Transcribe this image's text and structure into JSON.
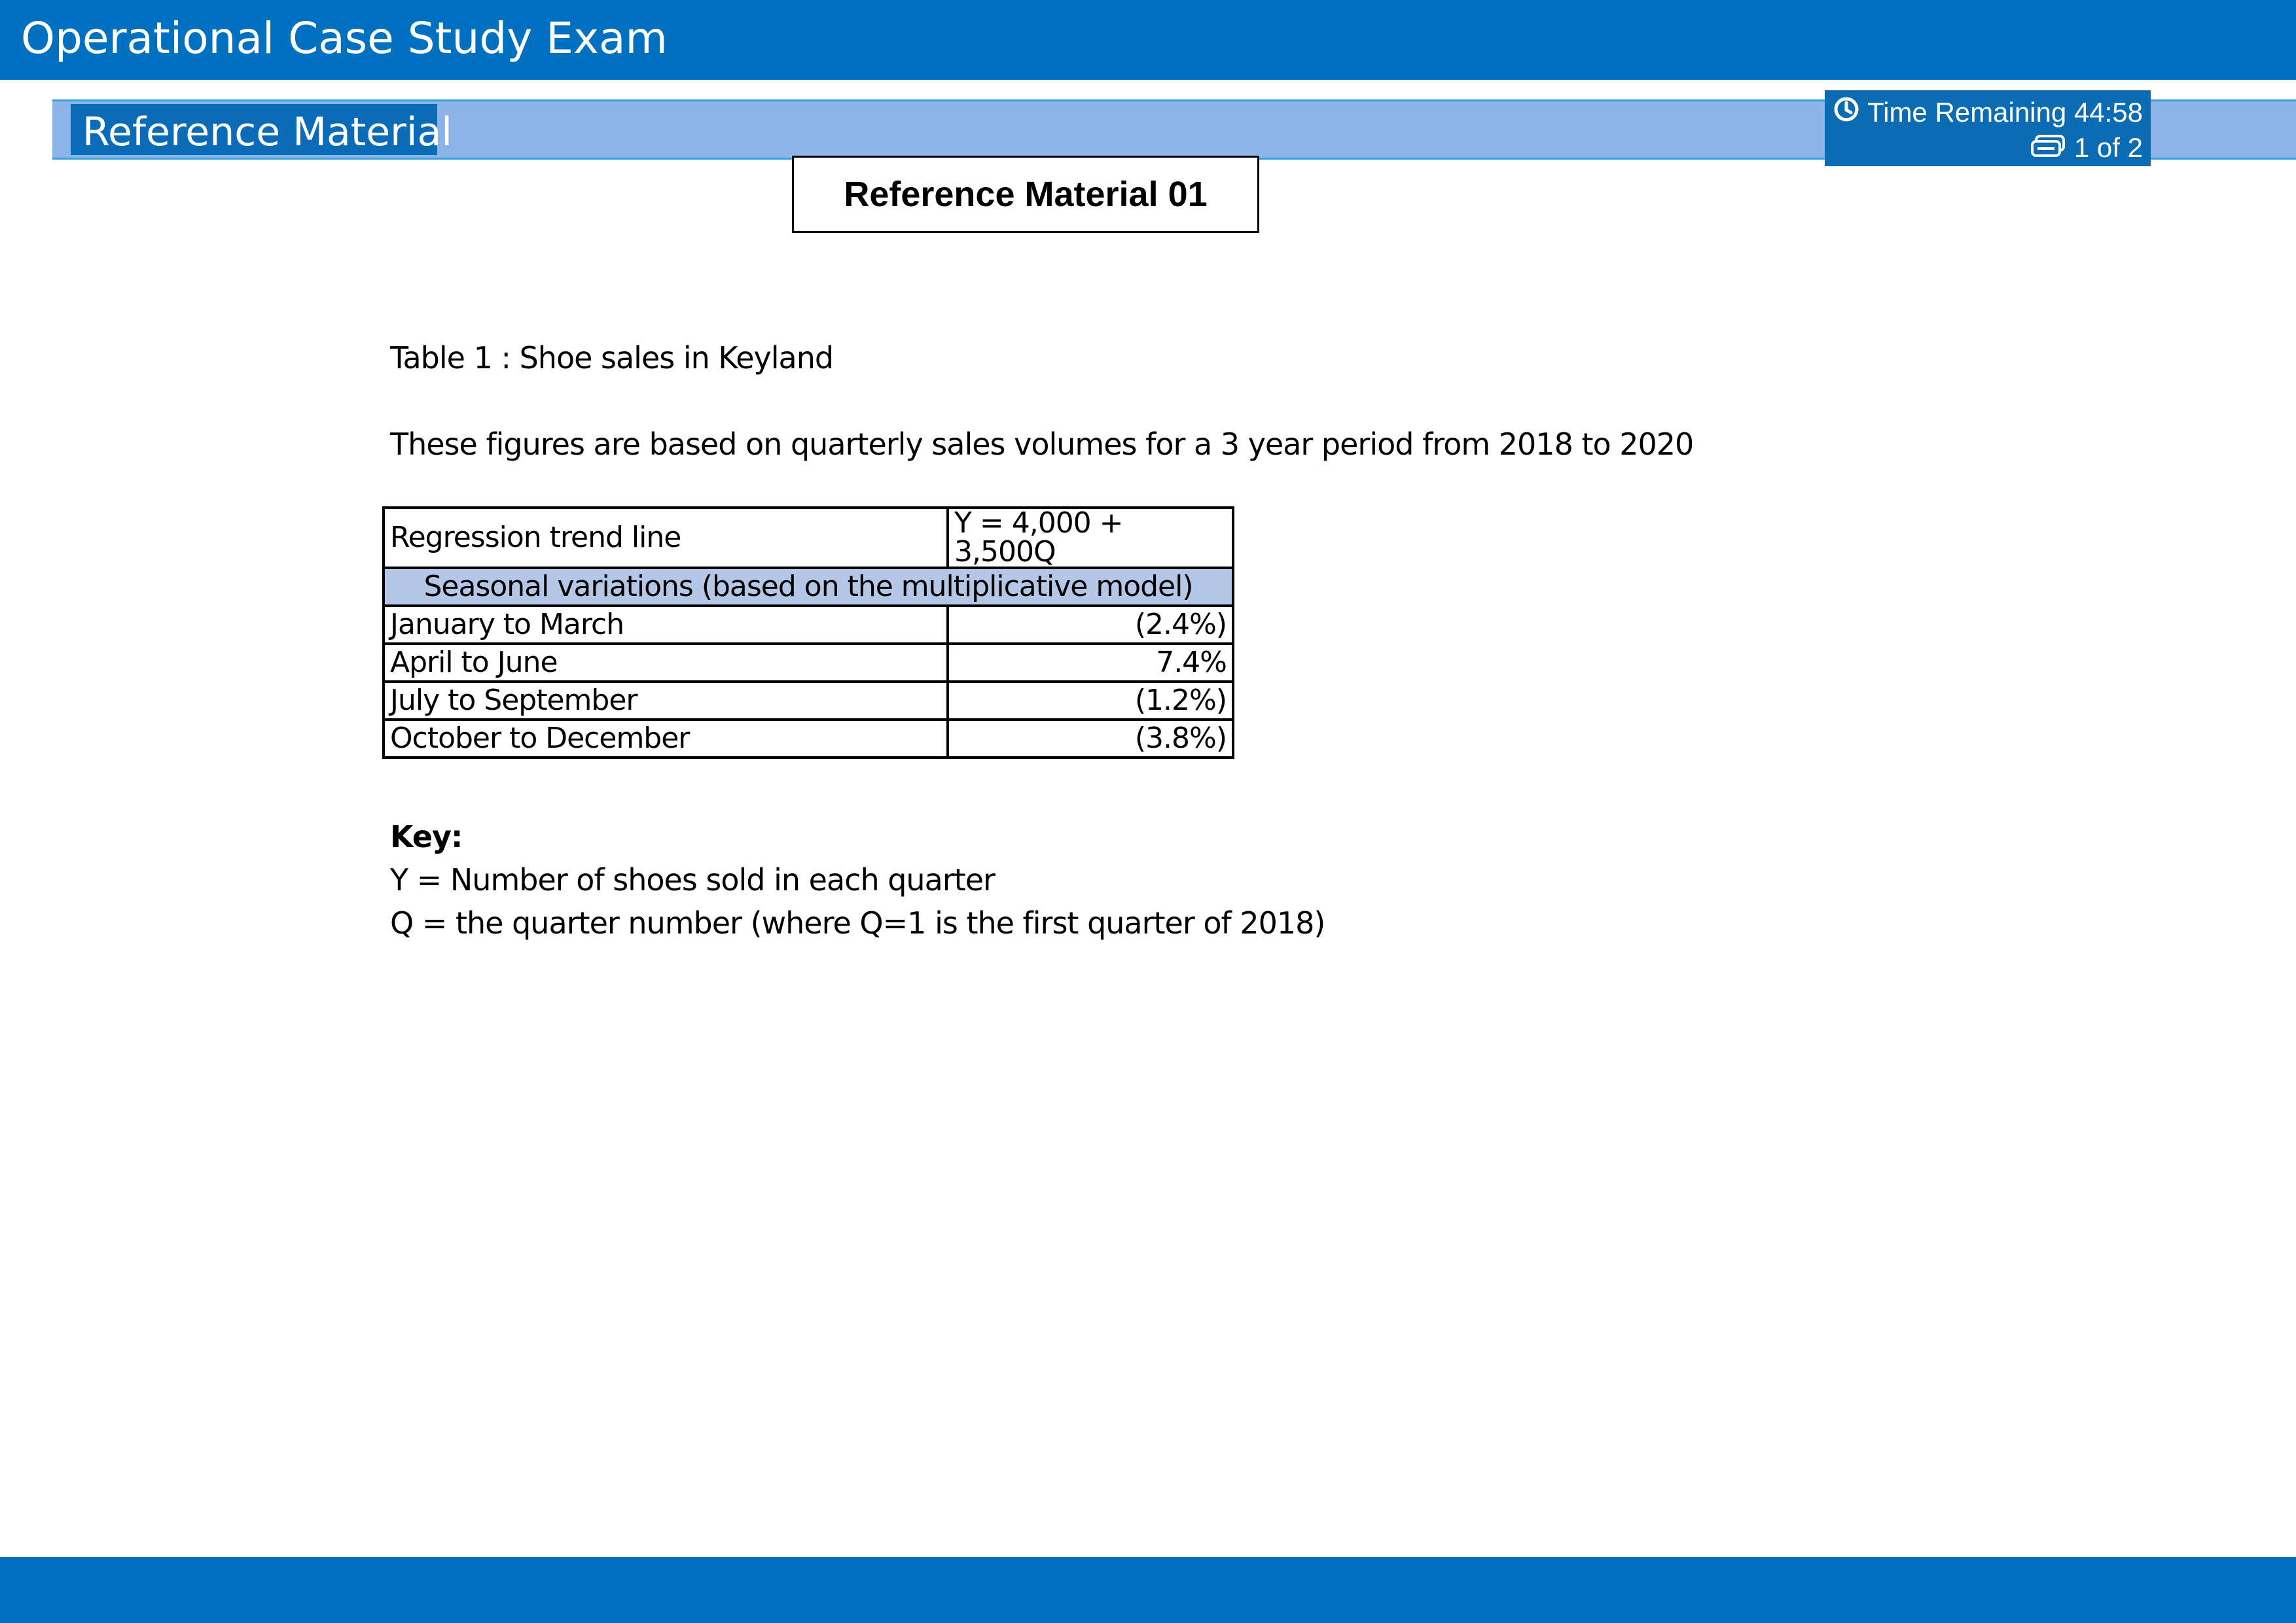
{
  "header": {
    "title": "Operational Case Study Exam"
  },
  "reference_bar": {
    "tab_label": "Reference Material"
  },
  "status": {
    "time_remaining": "Time Remaining 44:58",
    "page_indicator": "1 of 2",
    "clock_icon": "clock-icon",
    "pages_icon": "pages-icon"
  },
  "material": {
    "title": "Reference Material 01",
    "table_caption": "Table 1 : Shoe sales in Keyland",
    "intro": "These figures are based on quarterly sales volumes for a 3 year period from 2018 to 2020",
    "table": {
      "trend_label": "Regression trend line",
      "trend_value": "Y = 4,000 + 3,500Q",
      "seasonal_header": "Seasonal variations (based on the multiplicative model)",
      "rows": [
        {
          "label": "January to March",
          "value": "(2.4%)"
        },
        {
          "label": "April to June",
          "value": "7.4%"
        },
        {
          "label": "July to September",
          "value": "(1.2%)"
        },
        {
          "label": "October to December",
          "value": "(3.8%)"
        }
      ]
    },
    "key": {
      "heading": "Key:",
      "line1": "Y = Number of shoes sold in each quarter",
      "line2": "Q = the quarter number (where Q=1 is the first quarter of 2018)"
    }
  },
  "colors": {
    "brand_blue": "#0070c0",
    "ref_bar": "#8db4e8",
    "table_header": "#b4c7e7"
  }
}
